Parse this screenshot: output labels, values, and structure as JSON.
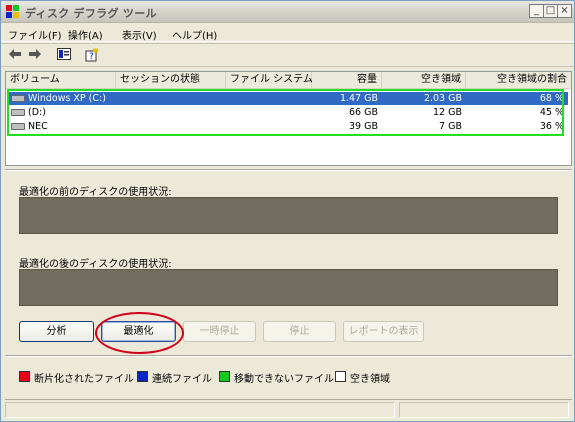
{
  "window": {
    "title": "ディスク デフラグ ツール",
    "controls": {
      "minimize": "_",
      "maximize": "□",
      "close": "×"
    }
  },
  "menu": [
    "ファイル(F)",
    "操作(A)",
    "表示(V)",
    "ヘルプ(H)"
  ],
  "toolbar": {
    "icons": [
      "back-arrow-icon",
      "forward-arrow-icon",
      "properties-icon",
      "help-icon"
    ]
  },
  "list": {
    "columns": [
      "ボリューム",
      "セッションの状態",
      "ファイル システム",
      "容量",
      "空き領域",
      "空き領域の割合"
    ],
    "rows": [
      {
        "volume": "Windows XP (C:)",
        "session": "",
        "fs": "",
        "capacity": "1.47 GB",
        "free": "2.03 GB",
        "percent": "68 %",
        "selected": true
      },
      {
        "volume": "(D:)",
        "session": "",
        "fs": "",
        "capacity": "66 GB",
        "free": "12 GB",
        "percent": "45 %",
        "selected": false
      },
      {
        "volume": "NEC",
        "session": "",
        "fs": "",
        "capacity": "39 GB",
        "free": "7 GB",
        "percent": "36 %",
        "selected": false
      }
    ]
  },
  "before_label": "最適化の前のディスクの使用状況:",
  "after_label": "最適化の後のディスクの使用状況:",
  "buttons": {
    "analyze": "分析",
    "defragment": "最適化",
    "pause": "一時停止",
    "stop": "停止",
    "view_report": "レポートの表示"
  },
  "legend": {
    "fragmented": {
      "label": "断片化されたファイル",
      "color": "#e4001b"
    },
    "contiguous": {
      "label": "連続ファイル",
      "color": "#0a24c8"
    },
    "unmovable": {
      "label": "移動できないファイル",
      "color": "#14c81e"
    },
    "free": {
      "label": "空き領域",
      "color": "#ffffff"
    }
  }
}
